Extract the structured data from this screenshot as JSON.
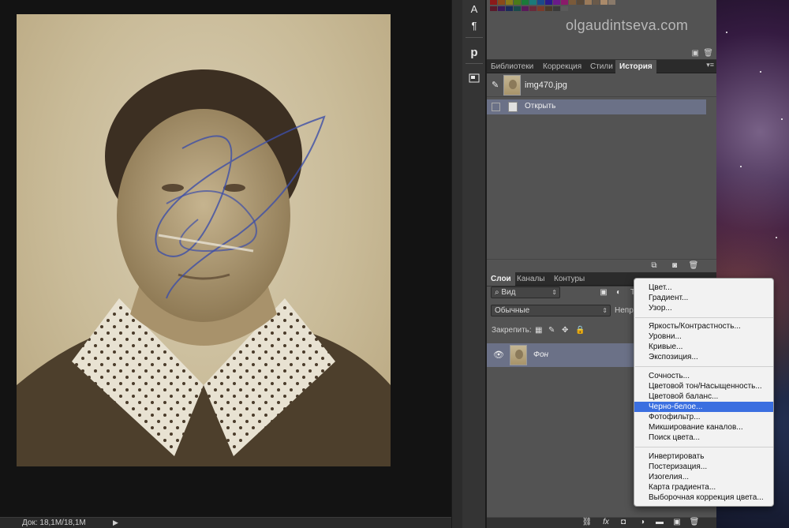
{
  "status_bar": {
    "doc_info": "Док: 18,1M/18,1M",
    "arrow": "▶"
  },
  "watermark": "olgaudintseva.com",
  "tools": {
    "char": "A",
    "para": "¶",
    "p_icon": "p"
  },
  "history_panel": {
    "tabs": [
      {
        "label": "Библиотеки"
      },
      {
        "label": "Коррекция"
      },
      {
        "label": "Стили"
      },
      {
        "label": "История"
      }
    ],
    "snapshot_name": "img470.jpg",
    "states": [
      {
        "label": "Открыть"
      }
    ]
  },
  "layers_panel": {
    "tabs": [
      {
        "label": "Слои"
      },
      {
        "label": "Каналы"
      },
      {
        "label": "Контуры"
      }
    ],
    "filter": {
      "label": "Вид"
    },
    "blend_mode": "Обычные",
    "opacity_label": "Непро",
    "lock_label": "Закрепить:",
    "layers": [
      {
        "name": "Фон"
      }
    ]
  },
  "adjustment_menu": {
    "groups": [
      [
        "Цвет...",
        "Градиент...",
        "Узор..."
      ],
      [
        "Яркость/Контрастность...",
        "Уровни...",
        "Кривые...",
        "Экспозиция..."
      ],
      [
        "Сочность...",
        "Цветовой тон/Насыщенность...",
        "Цветовой баланс...",
        "Черно-белое...",
        "Фотофильтр...",
        "Микширование каналов...",
        "Поиск цвета..."
      ],
      [
        "Инвертировать",
        "Постеризация...",
        "Изогелия...",
        "Карта градиента...",
        "Выборочная коррекция цвета..."
      ]
    ],
    "selected": "Черно-белое..."
  },
  "colors": {
    "selection": "#3b6fe0",
    "active_row": "#6b7187",
    "panel_bg": "#535353"
  }
}
